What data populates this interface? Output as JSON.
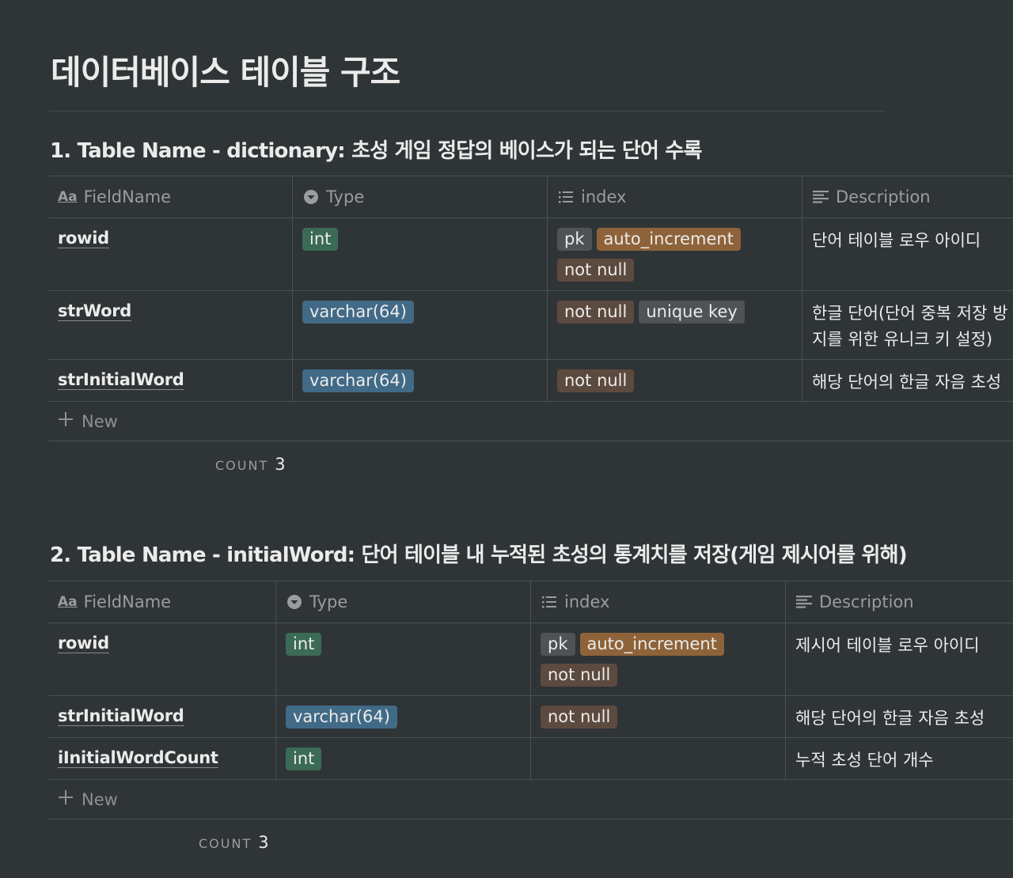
{
  "page": {
    "title": "데이터베이스 테이블 구조"
  },
  "columns": {
    "field": "FieldName",
    "type": "Type",
    "index": "index",
    "description": "Description",
    "aa": "Aa"
  },
  "new_label": "New",
  "count_label": "COUNT",
  "table1": {
    "heading": "1. Table Name - dictionary: 초성 게임 정답의 베이스가 되는 단어 수록",
    "count": "3",
    "rows": [
      {
        "field": "rowid",
        "type": "int",
        "tags": [
          "pk",
          "auto_increment",
          "not null"
        ],
        "desc": "단어 테이블 로우 아이디"
      },
      {
        "field": "strWord",
        "type": "varchar(64)",
        "tags": [
          "not null",
          "unique key"
        ],
        "desc": "한글 단어(단어 중복 저장 방지를 위한 유니크 키 설정)"
      },
      {
        "field": "strInitialWord",
        "type": "varchar(64)",
        "tags": [
          "not null"
        ],
        "desc": "해당 단어의 한글 자음 초성"
      }
    ]
  },
  "table2": {
    "heading": "2. Table Name - initialWord: 단어 테이블 내 누적된 초성의 통계치를 저장(게임 제시어를 위해)",
    "count": "3",
    "rows": [
      {
        "field": "rowid",
        "type": "int",
        "tags": [
          "pk",
          "auto_increment",
          "not null"
        ],
        "desc": "제시어 테이블 로우 아이디"
      },
      {
        "field": "strInitialWord",
        "type": "varchar(64)",
        "tags": [
          "not null"
        ],
        "desc": "해당 단어의 한글 자음 초성"
      },
      {
        "field": "iInitialWordCount",
        "type": "int",
        "tags": [],
        "desc": "누적 초성 단어 개수"
      }
    ]
  },
  "colors": {
    "background": "#2f3437",
    "tag_int": "#3b6a55",
    "tag_varchar": "#416a87",
    "tag_not_null": "#5d4a3f",
    "tag_auto_increment": "#8e6339",
    "tag_gray": "#4f5356"
  }
}
